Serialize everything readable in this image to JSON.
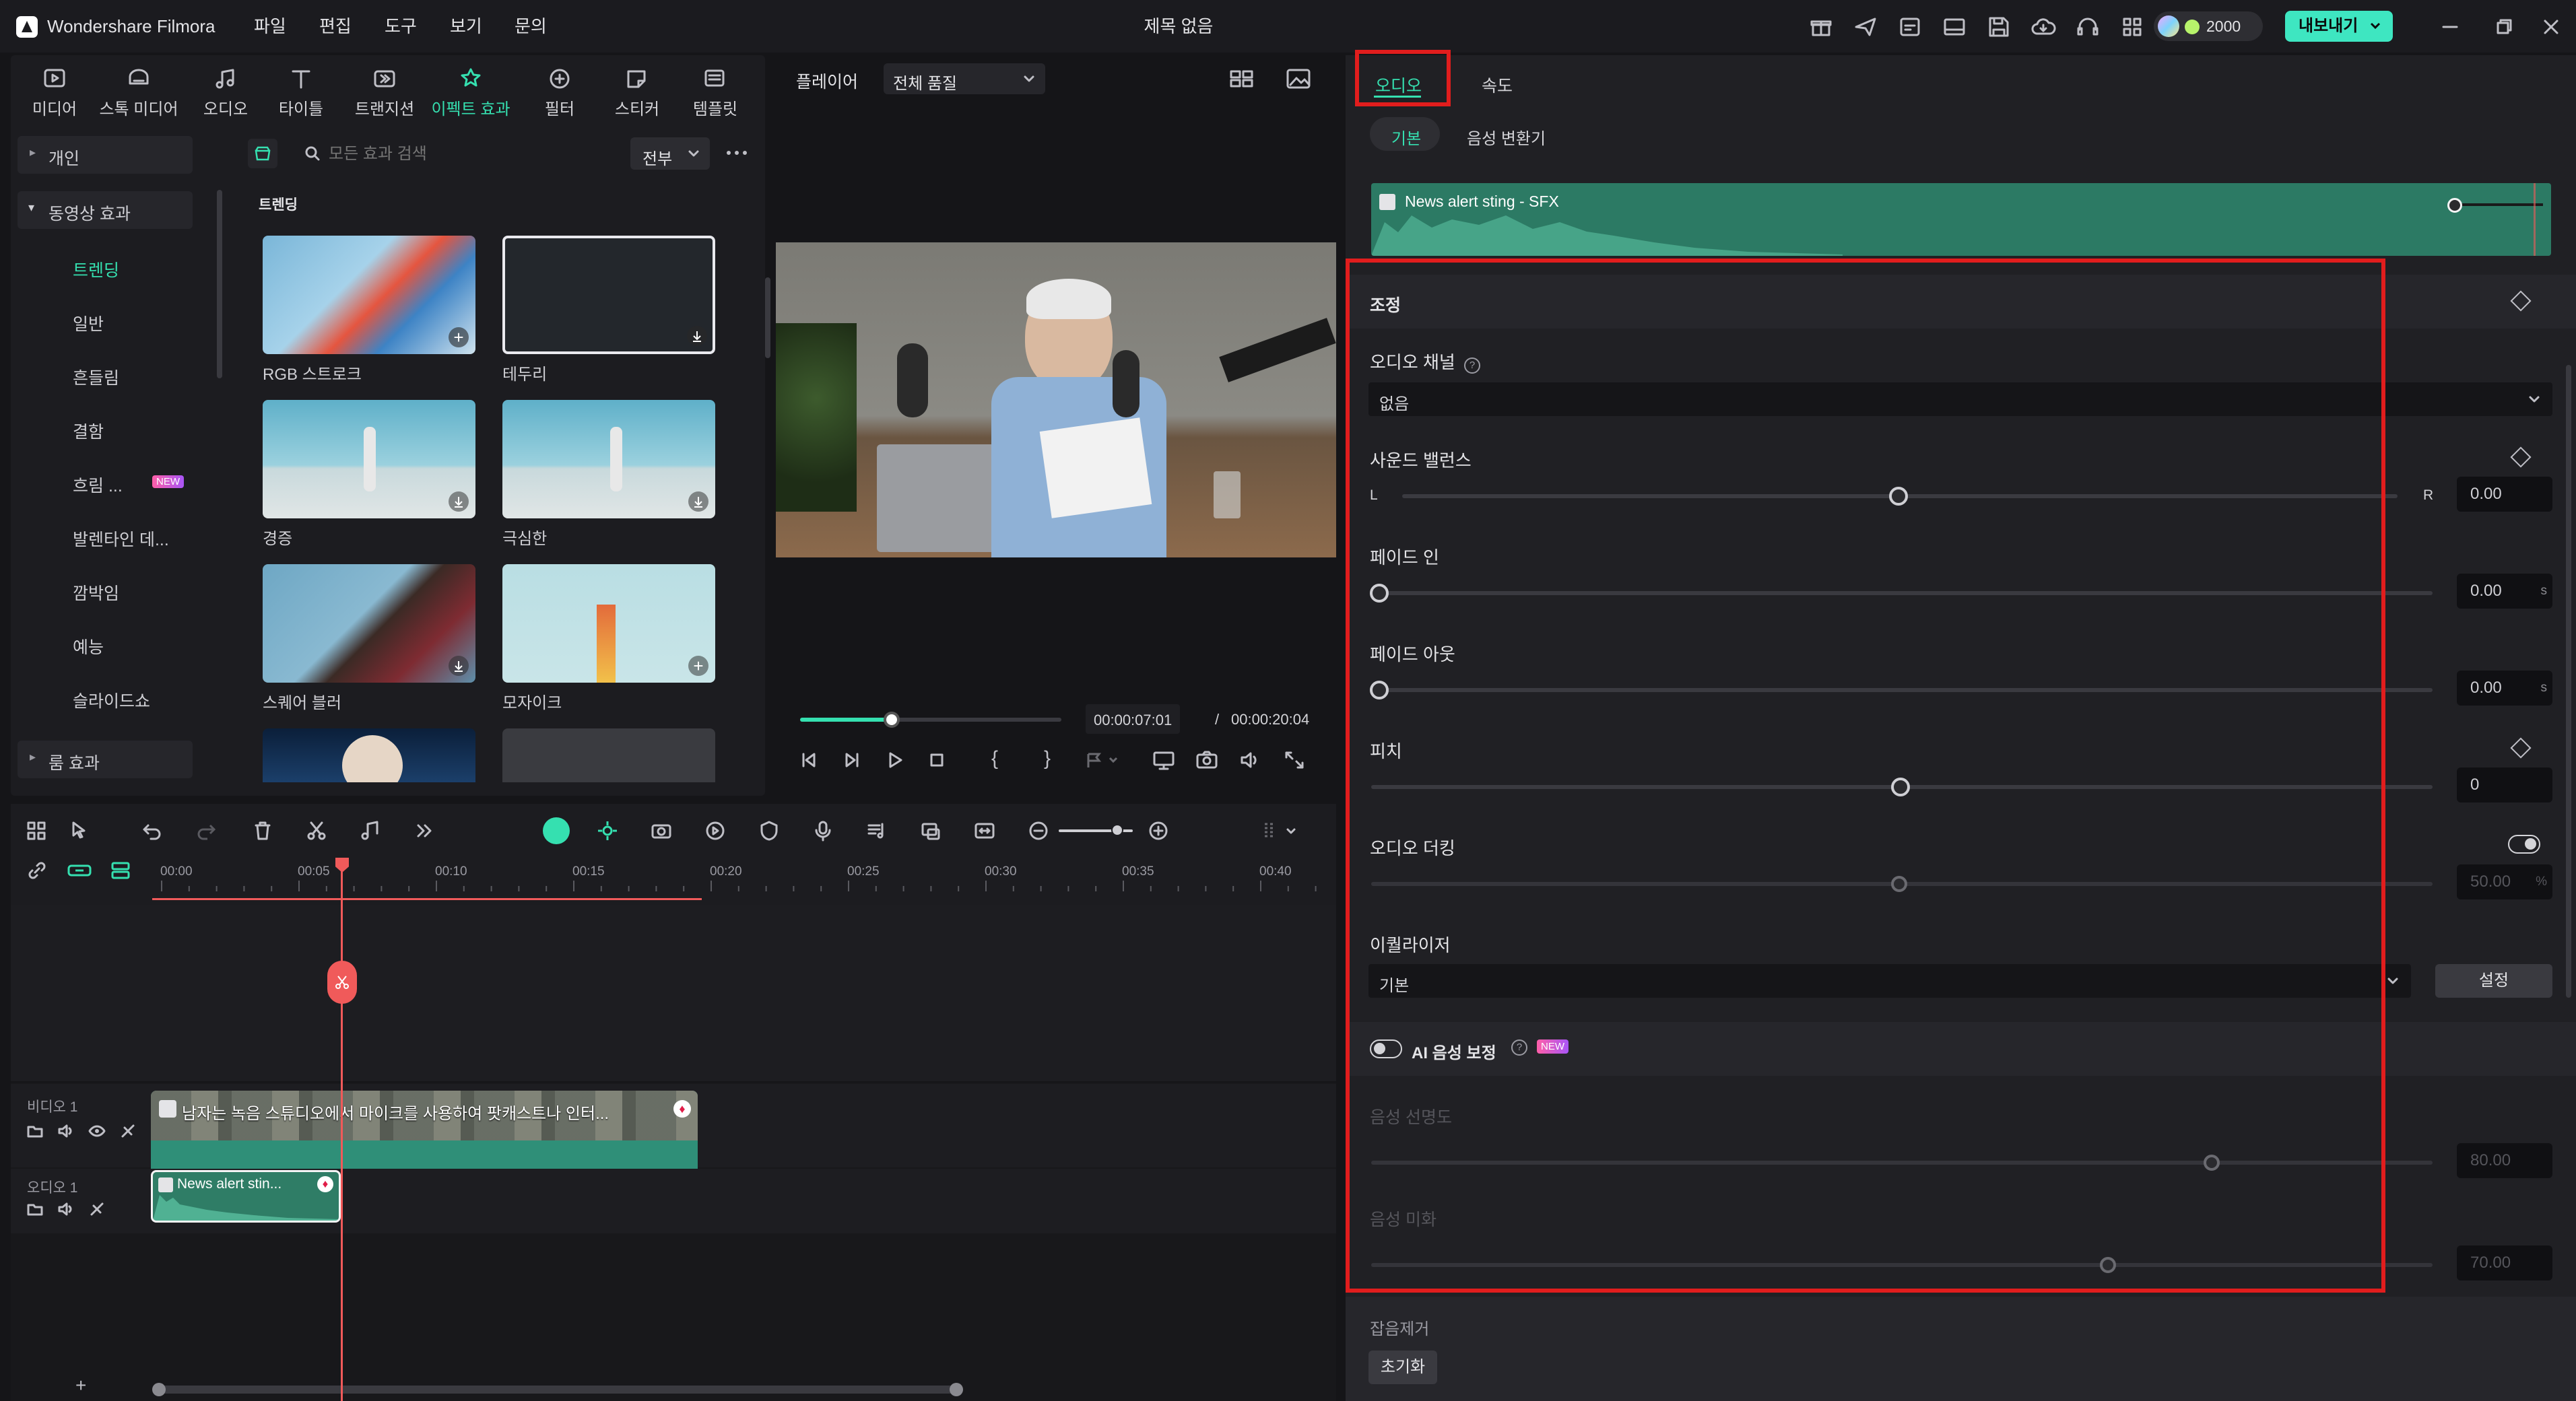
{
  "app": {
    "name": "Wondershare Filmora",
    "title": "제목 없음"
  },
  "menu": [
    "파일",
    "편집",
    "도구",
    "보기",
    "문의"
  ],
  "credits": "2000",
  "export_label": "내보내기",
  "media_tabs": [
    "미디어",
    "스톡 미디어",
    "오디오",
    "타이틀",
    "트랜지션",
    "이펙트 효과",
    "필터",
    "스티커",
    "템플릿"
  ],
  "active_media_tab": "이펙트 효과",
  "sidebar": {
    "personal": "개인",
    "video_effects": "동영상 효과",
    "items": [
      "트렌딩",
      "일반",
      "흔들림",
      "결함",
      "흐림 ...",
      "발렌타인 데...",
      "깜박임",
      "예능",
      "슬라이드쇼"
    ],
    "new_badge": "NEW",
    "room_effects": "룸 효과"
  },
  "effects": {
    "search_placeholder": "모든 효과 검색",
    "filter": "전부",
    "section": "트렌딩",
    "thumbs": [
      {
        "label": "RGB 스트로크"
      },
      {
        "label": "테두리"
      },
      {
        "label": "경증"
      },
      {
        "label": "극심한"
      },
      {
        "label": "스퀘어 블러"
      },
      {
        "label": "모자이크"
      }
    ]
  },
  "player": {
    "label": "플레이어",
    "quality": "전체 품질",
    "current_time": "00:00:07:01",
    "separator": "/",
    "total_time": "00:00:20:04",
    "progress": 0.35
  },
  "timeline": {
    "ticks": [
      "00:00",
      "00:05",
      "00:10",
      "00:15",
      "00:20",
      "00:25",
      "00:30",
      "00:35",
      "00:40"
    ],
    "video_track": "비디오 1",
    "audio_track": "오디오 1",
    "video_clip": "남자는 녹음 스튜디오에서 마이크를 사용하여 팟캐스트나 인터...",
    "audio_clip": "News alert stin..."
  },
  "inspector": {
    "tabs": [
      "오디오",
      "속도"
    ],
    "subtabs": [
      "기본",
      "음성 변환기"
    ],
    "clip_name": "News alert sting - SFX",
    "section_title": "조정",
    "audio_channel": {
      "label": "오디오 채널",
      "value": "없음"
    },
    "sound_balance": {
      "label": "사운드 밸런스",
      "left": "L",
      "right": "R",
      "value": "0.00",
      "position": 0.5
    },
    "fade_in": {
      "label": "페이드 인",
      "value": "0.00",
      "unit": "s",
      "position": 0
    },
    "fade_out": {
      "label": "페이드 아웃",
      "value": "0.00",
      "unit": "s",
      "position": 0
    },
    "pitch": {
      "label": "피치",
      "value": "0",
      "position": 0.5
    },
    "ducking": {
      "label": "오디오 더킹",
      "value": "50.00",
      "unit": "%",
      "position": 0.5
    },
    "equalizer": {
      "label": "이퀄라이저",
      "value": "기본",
      "button": "설정"
    },
    "ai_voice": {
      "label": "AI 음성 보정",
      "badge": "NEW"
    },
    "voice_clarity": {
      "label": "음성 선명도",
      "value": "80.00",
      "position": 0.8
    },
    "voice_beautify": {
      "label": "음성 미화",
      "value": "70.00",
      "position": 0.7
    },
    "denoise": {
      "label": "잡음제거"
    },
    "reset": "초기화"
  },
  "colors": {
    "accent": "#35e0b0",
    "highlight": "#e11d1d",
    "playhead": "#f05a5a",
    "clip_video": "#2f8f78",
    "clip_audio": "#2f7d66"
  }
}
